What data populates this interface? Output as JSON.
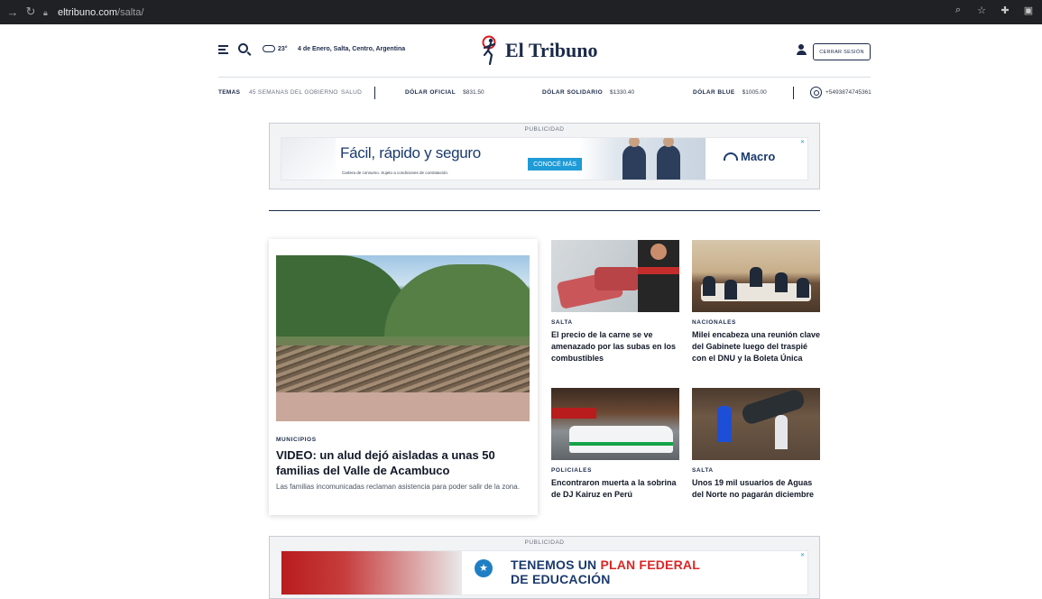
{
  "browser": {
    "url_host": "eltribuno.com",
    "url_path": "/salta/"
  },
  "header": {
    "temperature": "23°",
    "date_location": "4 de Enero, Salta, Centro, Argentina",
    "logo_text": "El Tribuno",
    "logout_label": "CERRAR SESIÓN"
  },
  "topics": {
    "label": "TEMAS",
    "items": [
      "45 SEMANAS DEL GOBIERNO",
      "SALUD"
    ]
  },
  "exchange": [
    {
      "name": "DÓLAR OFICIAL",
      "value": "$831.50"
    },
    {
      "name": "DÓLAR SOLIDARIO",
      "value": "$1330.40"
    },
    {
      "name": "DÓLAR BLUE",
      "value": "$1005.00"
    }
  ],
  "whatsapp": "+5493874745361",
  "ad_top": {
    "label": "PUBLICIDAD",
    "headline": "Fácil, rápido y seguro",
    "fine_print": "Cartera de consumo. Sujeto a condiciones de contratación.",
    "cta": "CONOCÉ MÁS",
    "brand": "Macro"
  },
  "feature": {
    "category": "MUNICIPIOS",
    "title": "VIDEO: un alud dejó aisladas a unas 50 familias del Valle de Acambuco",
    "subtitle": "Las familias incomunicadas reclaman asistencia para poder salir de la zona."
  },
  "cards": [
    {
      "category": "SALTA",
      "title": "El precio de la carne se ve amenazado por las subas en los combustibles"
    },
    {
      "category": "NACIONALES",
      "title": "Milei encabeza una reunión clave del Gabinete luego del traspié con el DNU y la Boleta Única"
    },
    {
      "category": "POLICIALES",
      "title": "Encontraron muerta a la sobrina de DJ Kairuz en Perú"
    },
    {
      "category": "SALTA",
      "title": "Unos 19 mil usuarios de Aguas del Norte no pagarán diciembre"
    }
  ],
  "ad_bottom": {
    "label": "PUBLICIDAD",
    "line1_a": "TENEMOS UN ",
    "line1_b": "PLAN FEDERAL",
    "line2": "DE EDUCACIÓN"
  }
}
